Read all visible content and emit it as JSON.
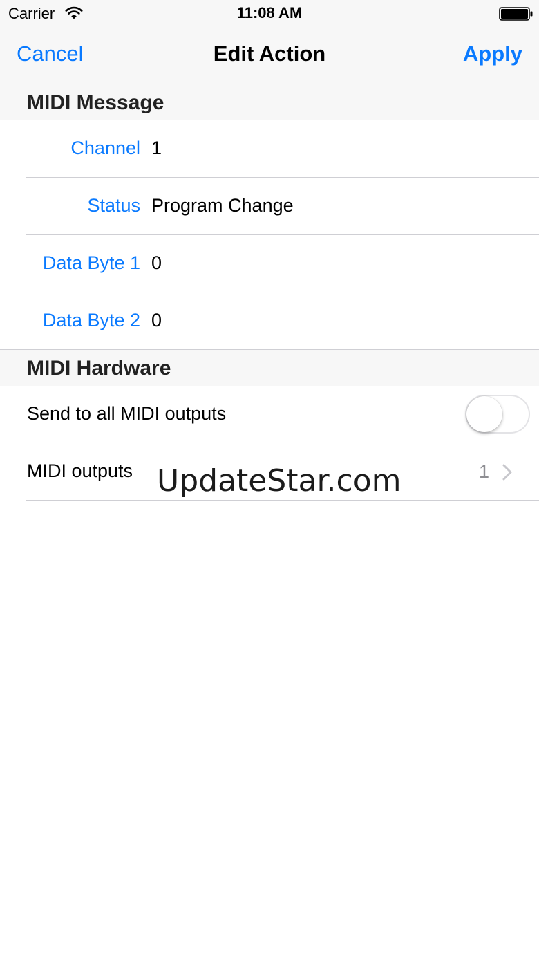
{
  "status_bar": {
    "carrier": "Carrier",
    "time": "11:08 AM",
    "wifi_icon": "wifi-icon",
    "battery_icon": "battery-icon"
  },
  "nav": {
    "left_button": "Cancel",
    "title": "Edit Action",
    "right_button": "Apply"
  },
  "sections": {
    "midi_message": {
      "header": "MIDI Message",
      "rows": [
        {
          "label": "Channel",
          "value": "1"
        },
        {
          "label": "Status",
          "value": "Program Change"
        },
        {
          "label": "Data Byte 1",
          "value": "0"
        },
        {
          "label": "Data Byte 2",
          "value": "0"
        }
      ]
    },
    "midi_hardware": {
      "header": "MIDI Hardware",
      "send_all_label": "Send to all MIDI outputs",
      "send_all_on": false,
      "outputs_label": "MIDI outputs",
      "outputs_count": "1"
    }
  },
  "watermark": "UpdateStar.com",
  "colors": {
    "accent": "#0a7aff",
    "bar_background": "#f7f7f7",
    "separator": "#cfcfd4",
    "detail_text": "#8e8e93"
  }
}
